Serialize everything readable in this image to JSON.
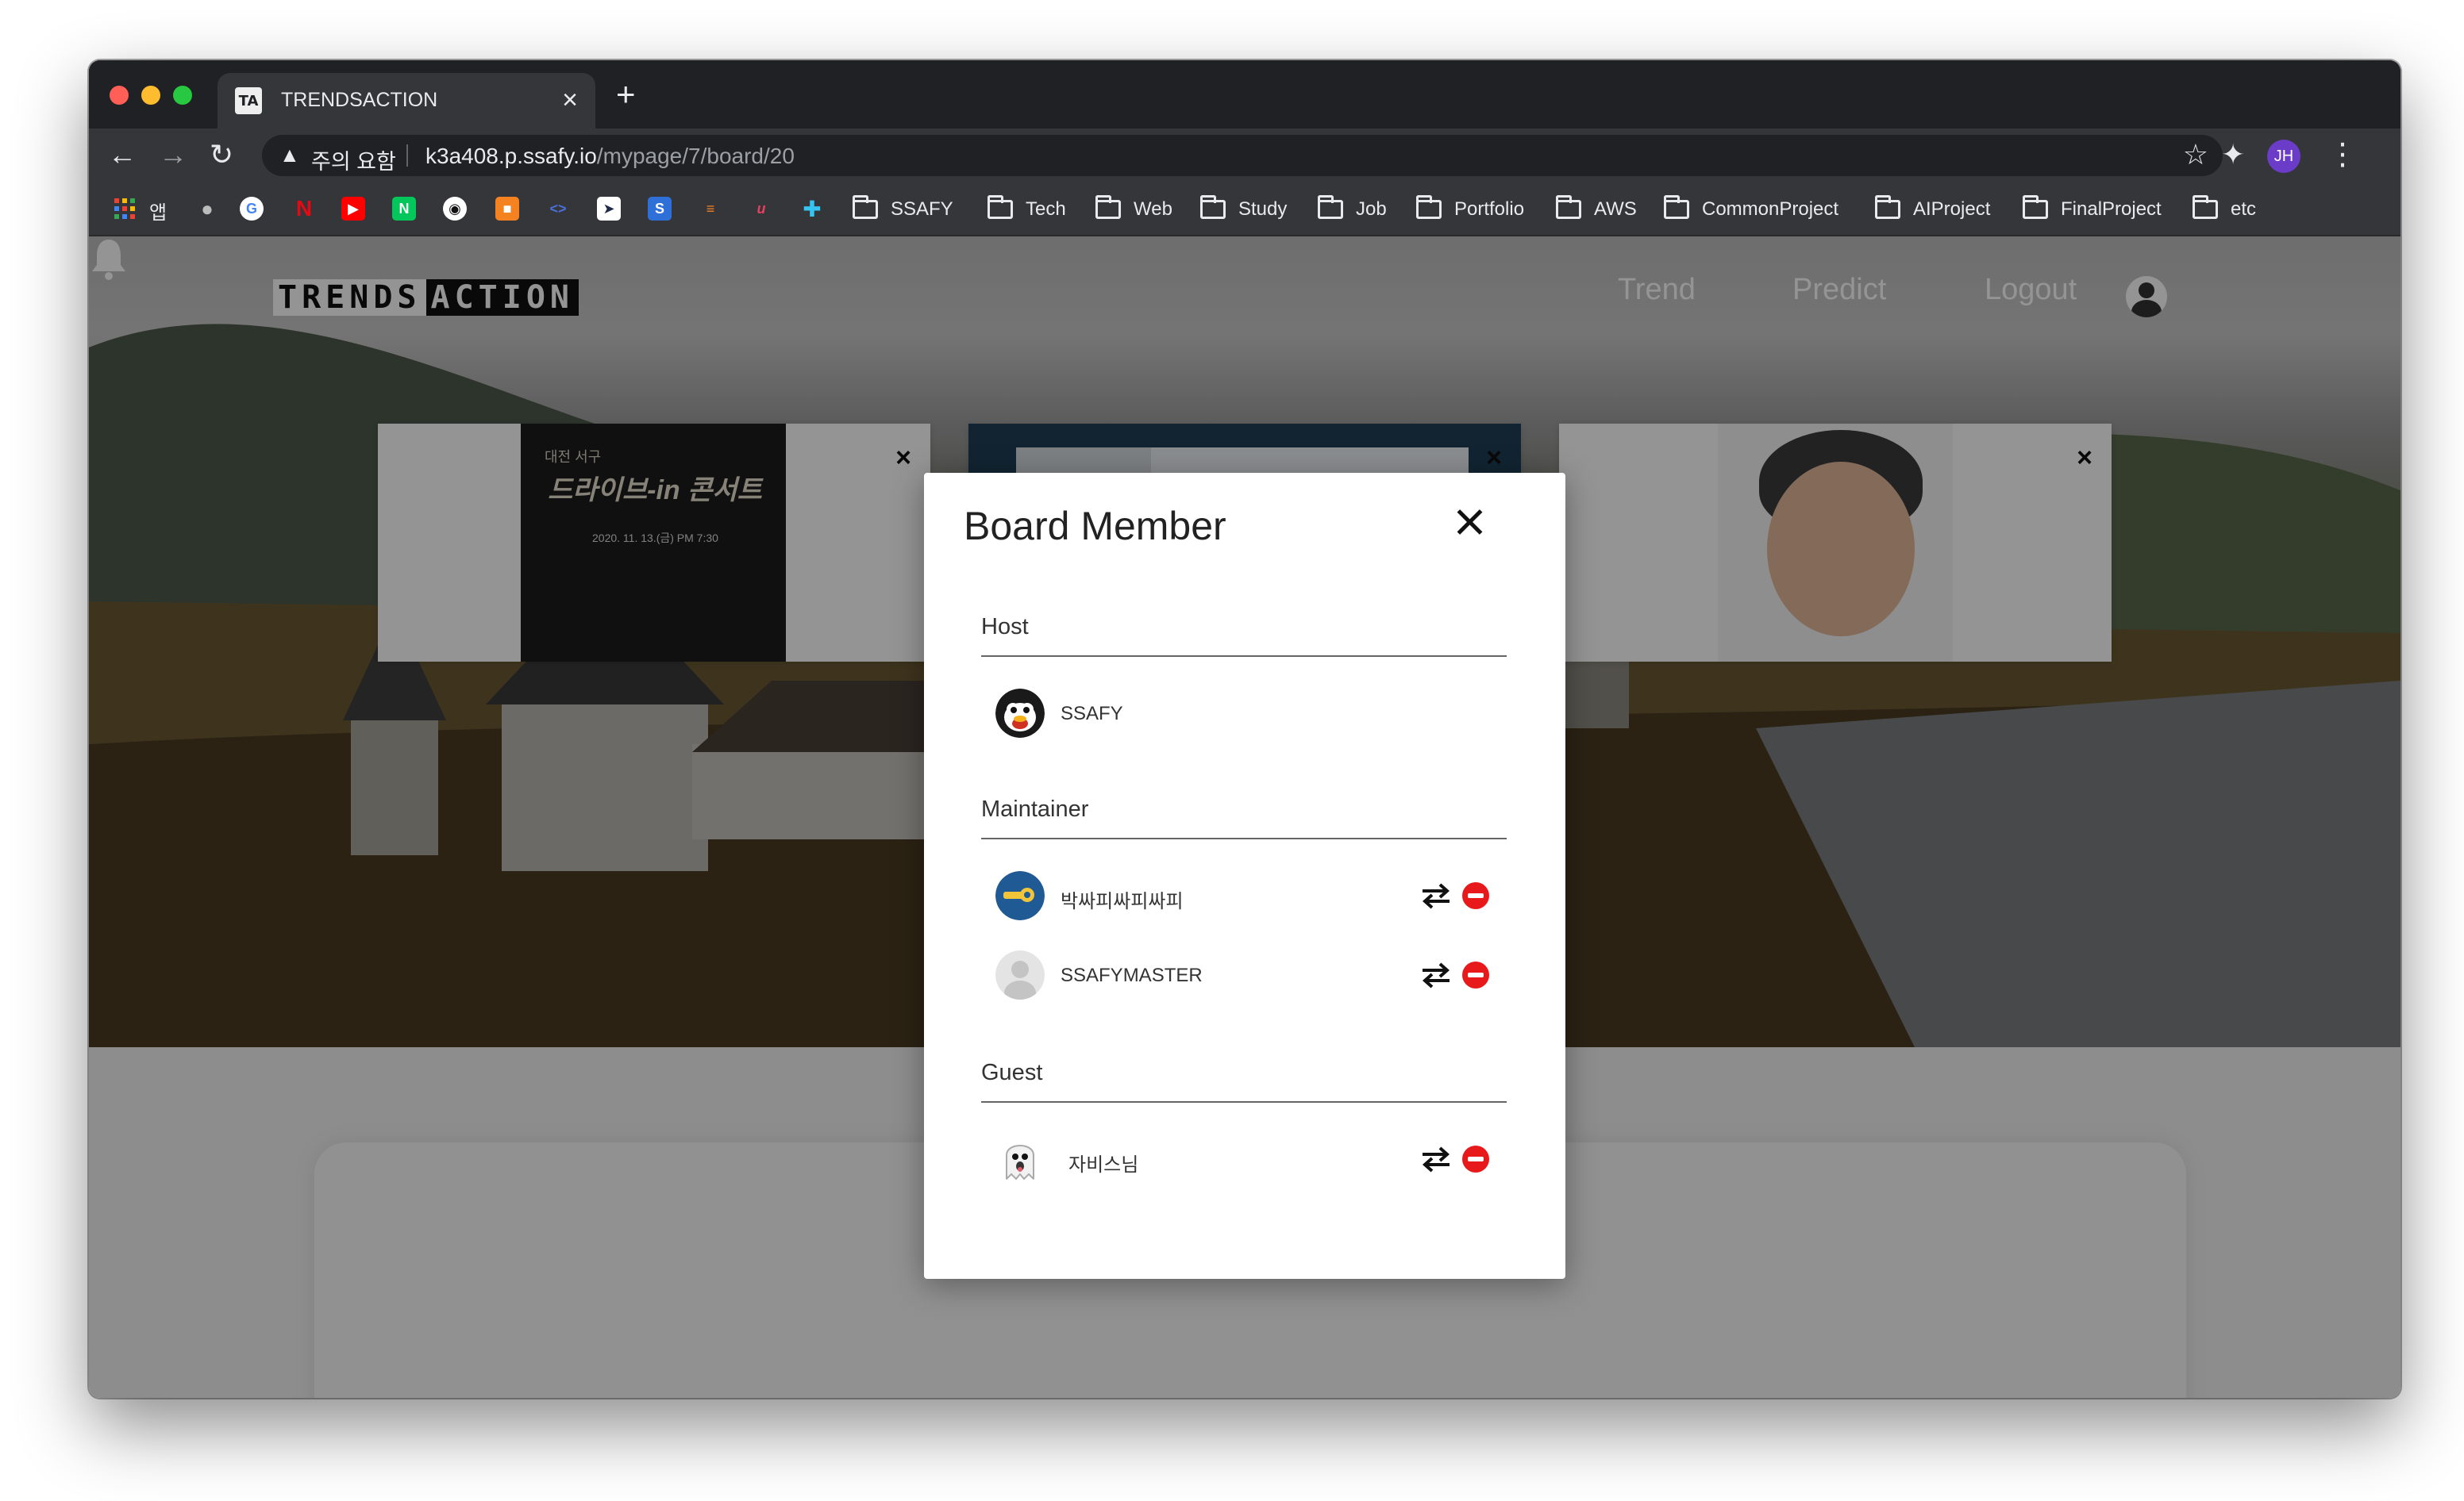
{
  "browser": {
    "tab_title": "TRENDSACTION",
    "tab_favicon": "TA",
    "tab_close": "×",
    "new_tab": "+",
    "security_warning": "주의 요함",
    "url_host": "k3a408.p.ssafy.io",
    "url_path": "/mypage/7/board/20",
    "profile_initials": "JH",
    "bookmarks_apps_label": "앱",
    "bookmark_folders": [
      "SSAFY",
      "Tech",
      "Web",
      "Study",
      "Job",
      "Portfolio",
      "AWS",
      "CommonProject",
      "AIProject",
      "FinalProject",
      "etc"
    ]
  },
  "site": {
    "logo_part1": "TRENDS",
    "logo_part2": "ACTION",
    "nav": [
      "Trend",
      "Predict",
      "Logout"
    ]
  },
  "modal": {
    "title": "Board Member",
    "sections": {
      "host": {
        "label": "Host",
        "members": [
          {
            "name": "SSAFY",
            "avatar": "penguin-avatar-icon"
          }
        ]
      },
      "maintainer": {
        "label": "Maintainer",
        "members": [
          {
            "name": "박싸피싸피싸피",
            "avatar": "blue-key-avatar-icon"
          },
          {
            "name": "SSAFYMASTER",
            "avatar": "default-user-avatar-icon"
          }
        ]
      },
      "guest": {
        "label": "Guest",
        "members": [
          {
            "name": "자비스님",
            "avatar": "ghost-avatar-icon"
          }
        ]
      }
    },
    "actions": {
      "swap_icon": "swap-role-icon",
      "remove_icon": "remove-member-icon"
    },
    "colors": {
      "remove": "#e8191b"
    }
  },
  "background_cards": {
    "poster1": {
      "line1": "대전 서구",
      "line2": "드라이브-in 콘서트",
      "line3": "2020. 11. 13.(금) PM 7:30"
    },
    "close_glyph": "×"
  }
}
